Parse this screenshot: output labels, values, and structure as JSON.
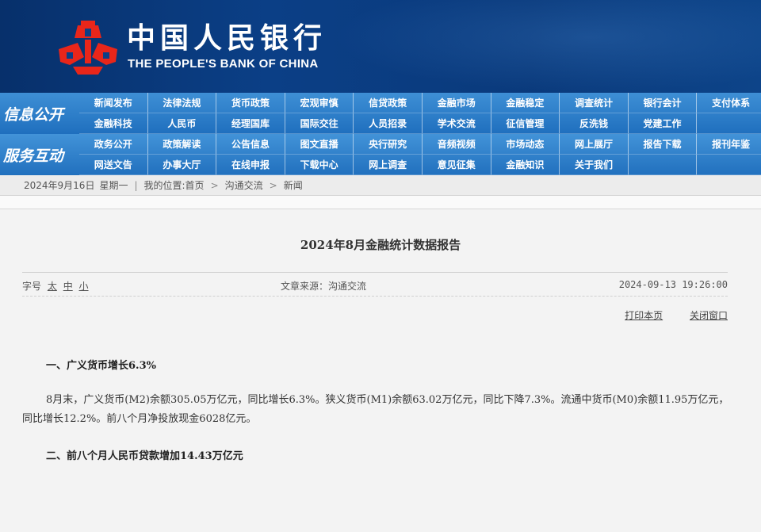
{
  "header": {
    "bank_name_cn": "中国人民银行",
    "bank_name_en": "THE PEOPLE'S BANK OF CHINA",
    "logo_icon": "pboc-logo-icon",
    "logo_color": "#e8261a",
    "banner_color": "#0b3f86"
  },
  "nav": {
    "group1_label": "信息公开",
    "group2_label": "服务互动",
    "group1_items": [
      "新闻发布",
      "法律法规",
      "货币政策",
      "宏观审慎",
      "信贷政策",
      "金融市场",
      "金融稳定",
      "调查统计",
      "银行会计",
      "支付体系",
      "金融科技",
      "人民币",
      "经理国库",
      "国际交往",
      "人员招录",
      "学术交流",
      "征信管理",
      "反洗钱",
      "党建工作",
      ""
    ],
    "group2_items": [
      "政务公开",
      "政策解读",
      "公告信息",
      "图文直播",
      "央行研究",
      "音频视频",
      "市场动态",
      "网上展厅",
      "报告下载",
      "报刊年鉴",
      "网送文告",
      "办事大厅",
      "在线申报",
      "下载中心",
      "网上调查",
      "意见征集",
      "金融知识",
      "关于我们",
      "",
      ""
    ]
  },
  "breadcrumb": {
    "date": "2024年9月16日",
    "weekday": "星期一",
    "location_prefix": "我的位置:首页",
    "level1": "沟通交流",
    "level2": "新闻",
    "separator": ">"
  },
  "article": {
    "title": "2024年8月金融统计数据报告",
    "font_size_label": "字号",
    "font_sizes": [
      "太",
      "中",
      "小"
    ],
    "source": "文章来源：沟通交流",
    "datetime": "2024-09-13 19:26:00",
    "print_label": "打印本页",
    "close_label": "关闭窗口",
    "section1_heading": "一、广义货币增长6.3%",
    "section1_body": "8月末，广义货币(M2)余额305.05万亿元，同比增长6.3%。狭义货币(M1)余额63.02万亿元，同比下降7.3%。流通中货币(M0)余额11.95万亿元，同比增长12.2%。前八个月净投放现金6028亿元。",
    "section2_heading": "二、前八个月人民币贷款增加14.43万亿元"
  }
}
